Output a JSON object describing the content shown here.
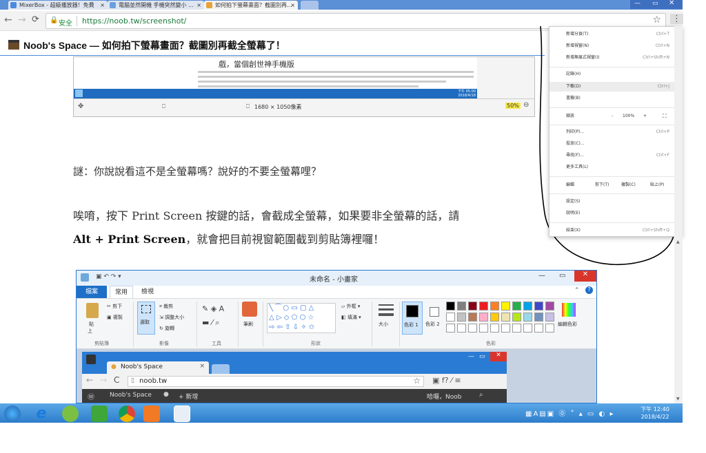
{
  "tabs": [
    {
      "label": "MixerBox - 超級播放器！免費",
      "color": "#4a8be0"
    },
    {
      "label": "電腦並然開機 手機突然變小 ...",
      "color": "#6aa0e0"
    },
    {
      "label": "如何拍下螢幕畫面？截圖別再...",
      "color": "#e8a23a"
    }
  ],
  "address": {
    "secure_label": "安全",
    "url": "https://noob.tw/screenshot/"
  },
  "page": {
    "title": "Noob's Space — 如何拍下螢幕畫面？截圖別再截全螢幕了！",
    "para1": "謎：你說說看這不是全螢幕嗎？說好的不要全螢幕哩？",
    "para2a": "唉唷，按下 Print Screen 按鍵的話，會截成全螢幕，如果要非全螢幕的話，請",
    "para2b_bold": "Alt + Print Screen",
    "para2b_rest": "，就會把目前視窗範圍截到剪貼簿裡囉！"
  },
  "embed_top": {
    "heading": "戲，當個創世神手機版",
    "resolution": "1680 × 1050像素",
    "zoom": "50%",
    "clock_time": "下午 05:00",
    "clock_date": "2018/4/18"
  },
  "menu": {
    "items": [
      {
        "label": "新增分頁(T)",
        "shortcut": "Ctrl+T"
      },
      {
        "label": "新增視窗(N)",
        "shortcut": "Ctrl+N"
      },
      {
        "label": "新增無痕式視窗(I)",
        "shortcut": "Ctrl+Shift+N"
      },
      {
        "label": "記錄(H)",
        "shortcut": ""
      },
      {
        "label": "下載(D)",
        "shortcut": "Ctrl+J"
      },
      {
        "label": "書籤(B)",
        "shortcut": ""
      },
      {
        "label": "列印(P)...",
        "shortcut": "Ctrl+P"
      },
      {
        "label": "投放(C)...",
        "shortcut": ""
      },
      {
        "label": "尋找(F)...",
        "shortcut": "Ctrl+F"
      },
      {
        "label": "更多工具(L)",
        "shortcut": ""
      },
      {
        "label": "設定(S)",
        "shortcut": ""
      },
      {
        "label": "說明(E)",
        "shortcut": ""
      },
      {
        "label": "結束(X)",
        "shortcut": "Ctrl+Shift+Q"
      }
    ],
    "zoom_label": "縮放",
    "zoom_minus": "-",
    "zoom_value": "100%",
    "zoom_plus": "+",
    "edit_label": "編輯",
    "cut": "剪下(T)",
    "copy": "複製(C)",
    "paste": "貼上(P)"
  },
  "paint": {
    "title": "未命名 - 小畫家",
    "tab_file": "檔案",
    "tab_home": "常用",
    "tab_view": "檢視",
    "paste": "貼",
    "paste2": "上",
    "cut": "剪下",
    "copy": "複製",
    "select": "選取",
    "crop": "裁剪",
    "resize": "調整大小",
    "rotate": "旋轉",
    "brush": "筆刷",
    "outline": "外框",
    "fill": "填滿",
    "size": "大小",
    "color1": "色彩 1",
    "color2": "色彩 2",
    "edit_colors": "編輯色彩",
    "grp_clipboard": "剪貼簿",
    "grp_image": "影像",
    "grp_tools": "工具",
    "grp_shapes": "形狀",
    "grp_colors": "色彩"
  },
  "inner_browser": {
    "tab": "Noob's Space",
    "url": "noob.tw",
    "bookmark1": "Noob's Space",
    "bookmark2": "新增",
    "user": "哈囉，Noob"
  },
  "taskbar": {
    "time": "下午 12:40",
    "date": "2018/4/22"
  },
  "palette": [
    "#000000",
    "#7f7f7f",
    "#880015",
    "#ed1c24",
    "#ff7f27",
    "#fff200",
    "#22b14c",
    "#00a2e8",
    "#3f48cc",
    "#a349a4",
    "#ffffff",
    "#c3c3c3",
    "#b97a57",
    "#ffaec9",
    "#ffc90e",
    "#efe4b0",
    "#b5e61d",
    "#99d9ea",
    "#7092be",
    "#c8bfe7"
  ]
}
